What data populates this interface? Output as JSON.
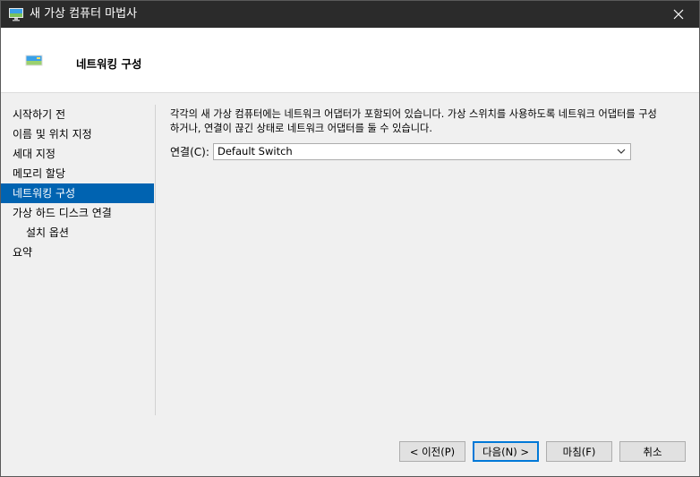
{
  "window": {
    "title": "새 가상 컴퓨터 마법사",
    "icon": "monitor-icon",
    "close_icon": "close-icon"
  },
  "header": {
    "title": "네트워킹 구성",
    "icon": "monitor-icon"
  },
  "sidebar": {
    "steps": [
      {
        "label": "시작하기 전",
        "active": false,
        "sub": false
      },
      {
        "label": "이름 및 위치 지정",
        "active": false,
        "sub": false
      },
      {
        "label": "세대 지정",
        "active": false,
        "sub": false
      },
      {
        "label": "메모리 할당",
        "active": false,
        "sub": false
      },
      {
        "label": "네트워킹 구성",
        "active": true,
        "sub": false
      },
      {
        "label": "가상 하드 디스크 연결",
        "active": false,
        "sub": false
      },
      {
        "label": "설치 옵션",
        "active": false,
        "sub": true
      },
      {
        "label": "요약",
        "active": false,
        "sub": false
      }
    ]
  },
  "content": {
    "description_lines": [
      "각각의 새 가상 컴퓨터에는 네트워크 어댑터가 포함되어 있습니다. 가상 스위치를 사용하도록 네트워크 어댑터를 구성",
      "하거나, 연결이 끊긴 상태로 네트워크 어댑터를 둘 수 있습니다."
    ],
    "connection_label": "연결(C):",
    "connection_value": "Default Switch"
  },
  "buttons": {
    "previous": "< 이전(P)",
    "next": "다음(N) >",
    "finish": "마침(F)",
    "cancel": "취소"
  },
  "colors": {
    "titlebar": "#2b2b2b",
    "selection": "#0063b1",
    "default_button_border": "#0078d7"
  }
}
